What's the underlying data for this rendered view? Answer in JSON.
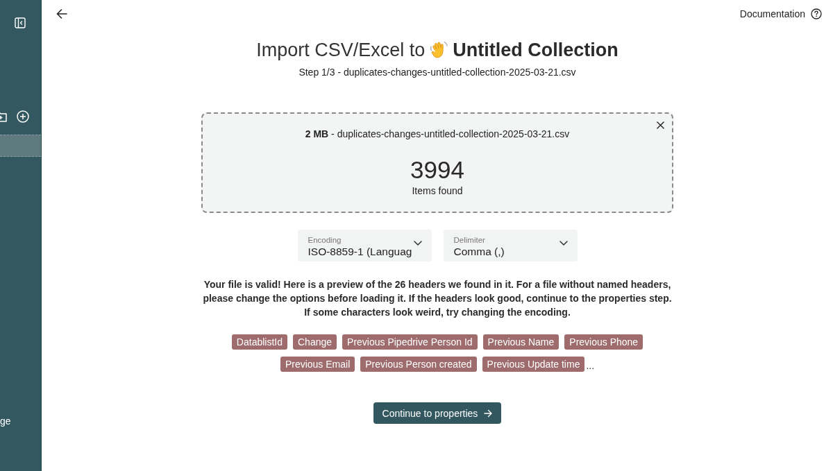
{
  "sidebar": {
    "rows": [
      {
        "selected": true
      }
    ],
    "footer_label": "ge"
  },
  "top_bar": {
    "documentation_link": "Documentation"
  },
  "title": {
    "prefix": "Import CSV/Excel to",
    "collection_name": "Untitled Collection"
  },
  "subtitle": "Step 1/3 - duplicates-changes-untitled-collection-2025-03-21.csv",
  "file_card": {
    "file_info": "**2 MB** - duplicates-changes-untitled-collection-2025-03-21.csv",
    "item_count": "3994",
    "item_count_label": "Items found"
  },
  "options": [
    {
      "label": "Encoding",
      "value": "ISO-8859-1 (Languag"
    },
    {
      "label": "Delimiter",
      "value": "Comma (,)"
    }
  ],
  "message": "Your file is valid! Here is a preview of the 26 headers we found in it. For a file without named headers, please change the options before loading it. If the headers look good, continue to the properties step. If some characters look weird, try changing the encoding.",
  "headers": [
    "DatablistId",
    "Change",
    "Previous Pipedrive Person Id",
    "Previous Name",
    "Previous Phone",
    "Previous Email",
    "Previous Person created",
    "Previous Update time"
  ],
  "more_indicator": "...",
  "primary_button": "Continue to properties"
}
